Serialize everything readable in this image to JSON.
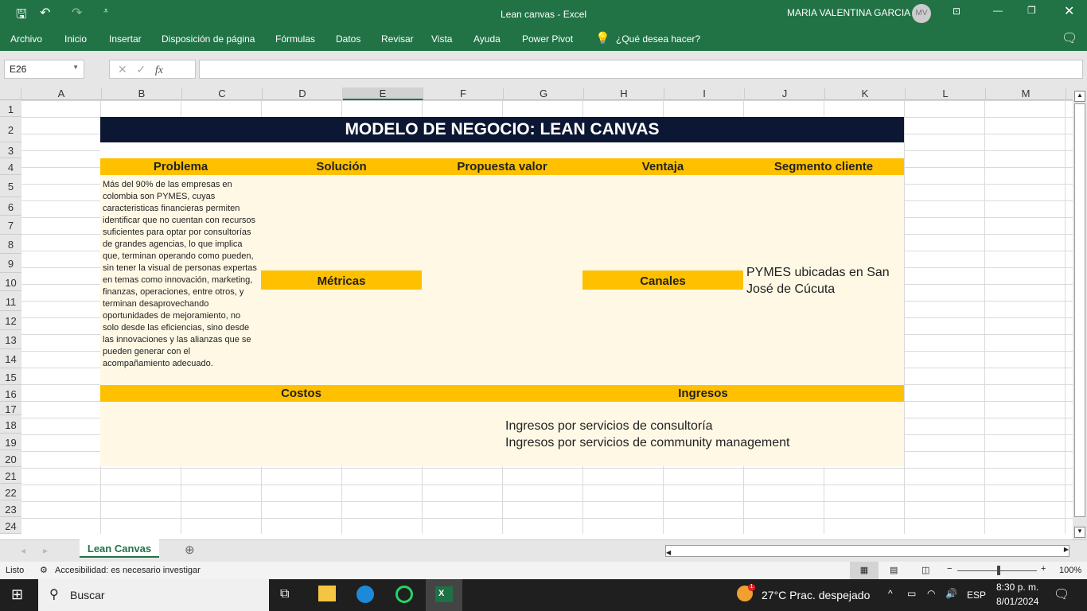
{
  "window": {
    "title": "Lean canvas  -  Excel",
    "user": "MARIA VALENTINA GARCIA",
    "avatar": "MV"
  },
  "menu": [
    "Archivo",
    "Inicio",
    "Insertar",
    "Disposición de página",
    "Fórmulas",
    "Datos",
    "Revisar",
    "Vista",
    "Ayuda",
    "Power Pivot"
  ],
  "tell_me": "¿Qué desea hacer?",
  "formula": {
    "name_box": "E26",
    "fx": "fx",
    "value": ""
  },
  "columns": [
    "A",
    "B",
    "C",
    "D",
    "E",
    "F",
    "G",
    "H",
    "I",
    "J",
    "K",
    "L",
    "M"
  ],
  "rows": [
    "1",
    "2",
    "3",
    "4",
    "5",
    "6",
    "7",
    "8",
    "9",
    "10",
    "11",
    "12",
    "13",
    "14",
    "15",
    "16",
    "17",
    "18",
    "19",
    "20",
    "21",
    "22",
    "23",
    "24"
  ],
  "canvas": {
    "title": "MODELO DE NEGOCIO: LEAN CANVAS",
    "headers": {
      "problema": "Problema",
      "solucion": "Solución",
      "propuesta": "Propuesta valor",
      "ventaja": "Ventaja",
      "segmento": "Segmento cliente",
      "metricas": "Métricas",
      "canales": "Canales",
      "costos": "Costos",
      "ingresos": "Ingresos"
    },
    "problema_text": "Más del 90% de las empresas en colombia son PYMES, cuyas caracteristicas financieras permiten identificar que no cuentan con recursos suficientes para optar por consultorías de grandes agencias, lo que implica que, terminan operando como pueden, sin tener la visual de personas expertas en temas como innovación, marketing, finanzas, operaciones, entre otros, y terminan desaprovechando oportunidades de mejoramiento, no solo desde las eficiencias, sino desde las innovaciones y las alianzas que se pueden generar con el acompañamiento adecuado.",
    "segmento_text": "PYMES ubicadas en San José de Cúcuta",
    "ingresos_lines": [
      "Ingresos por servicios de consultoría",
      "Ingresos por servicios de community management"
    ]
  },
  "sheet_tab": "Lean Canvas",
  "status": {
    "ready": "Listo",
    "accessibility": "Accesibilidad: es necesario investigar",
    "zoom": "100%",
    "zoom_fraction": 0.5
  },
  "taskbar": {
    "search": "Buscar",
    "weather": "27°C  Prac. despejado",
    "lang": "ESP",
    "time": "8:30 p. m.",
    "date": "8/01/2024",
    "weather_badge": "1"
  },
  "colors": {
    "excel_green": "#217346",
    "title_bg": "#0c1733",
    "header_orange": "#ffc000",
    "cell_cream": "#fff8e5"
  }
}
